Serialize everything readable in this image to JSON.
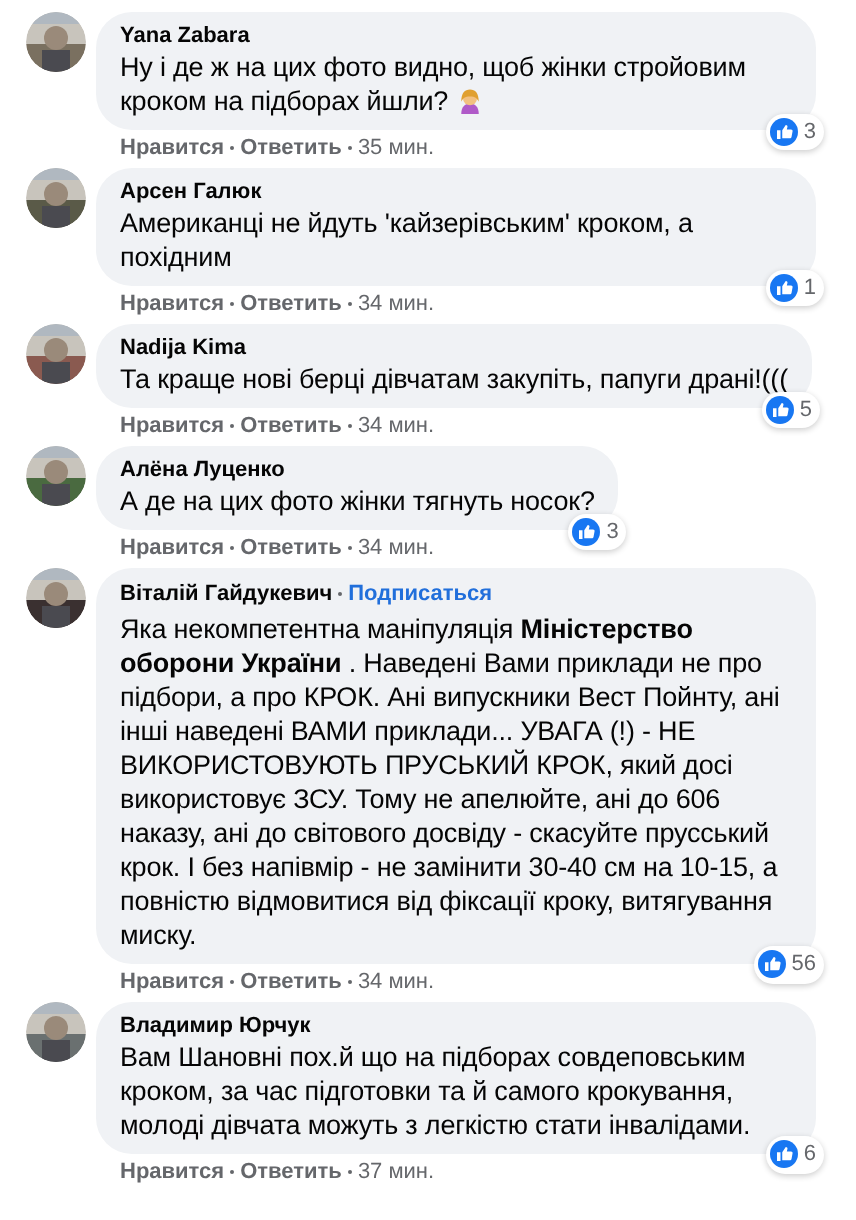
{
  "comments": [
    {
      "author": "Yana Zabara",
      "text": "Ну і де ж на цих фото видно, щоб жінки стройовим кроком на підборах йшли?",
      "has_emoji": true,
      "reactions": "3",
      "like": "Нравится",
      "reply": "Ответить",
      "time": "35 мин."
    },
    {
      "author": "Арсен Галюк",
      "text": "Американці не йдуть 'кайзерівським' кроком, а похідним",
      "reactions": "1",
      "like": "Нравится",
      "reply": "Ответить",
      "time": "34 мин."
    },
    {
      "author": "Nadija Kima",
      "text": "Та краще нові берці дівчатам закупіть, папуги драні!(((",
      "reactions": "5",
      "like": "Нравится",
      "reply": "Ответить",
      "time": "34 мин."
    },
    {
      "author": "Алёна Луценко",
      "text": "А де на цих фото жінки тягнуть носок?",
      "reactions": "3",
      "like": "Нравится",
      "reply": "Ответить",
      "time": "34 мин."
    },
    {
      "author": "Віталій Гайдукевич",
      "follow": "Подписаться",
      "text": "Яка некомпетентна маніпуляція **Міністерство оборони України** . Наведені Вами приклади не про підбори, а про КРОК. Ані випускники Вест Пойнту, ані інші наведені ВАМИ приклади... УВАГА (!) - НЕ ВИКОРИСТОВУЮТЬ ПРУСЬКИЙ КРОК, який досі використовує ЗСУ. Тому не апелюйте, ані до 606 наказу, ані до світового досвіду - скасуйте прусський крок. І без напівмір - не замінити 30-40 см на 10-15, а повністю відмовитися від фіксації кроку, витягування миску.",
      "reactions": "56",
      "like": "Нравится",
      "reply": "Ответить",
      "time": "34 мин."
    },
    {
      "author": "Владимир Юрчук",
      "text": "Вам Шановні пох.й що на підборах совдеповським кроком, за час підготовки та й самого крокування, молоді дівчата можуть з легкістю стати інвалідами.",
      "reactions": "6",
      "like": "Нравится",
      "reply": "Ответить",
      "time": "37 мин."
    }
  ]
}
